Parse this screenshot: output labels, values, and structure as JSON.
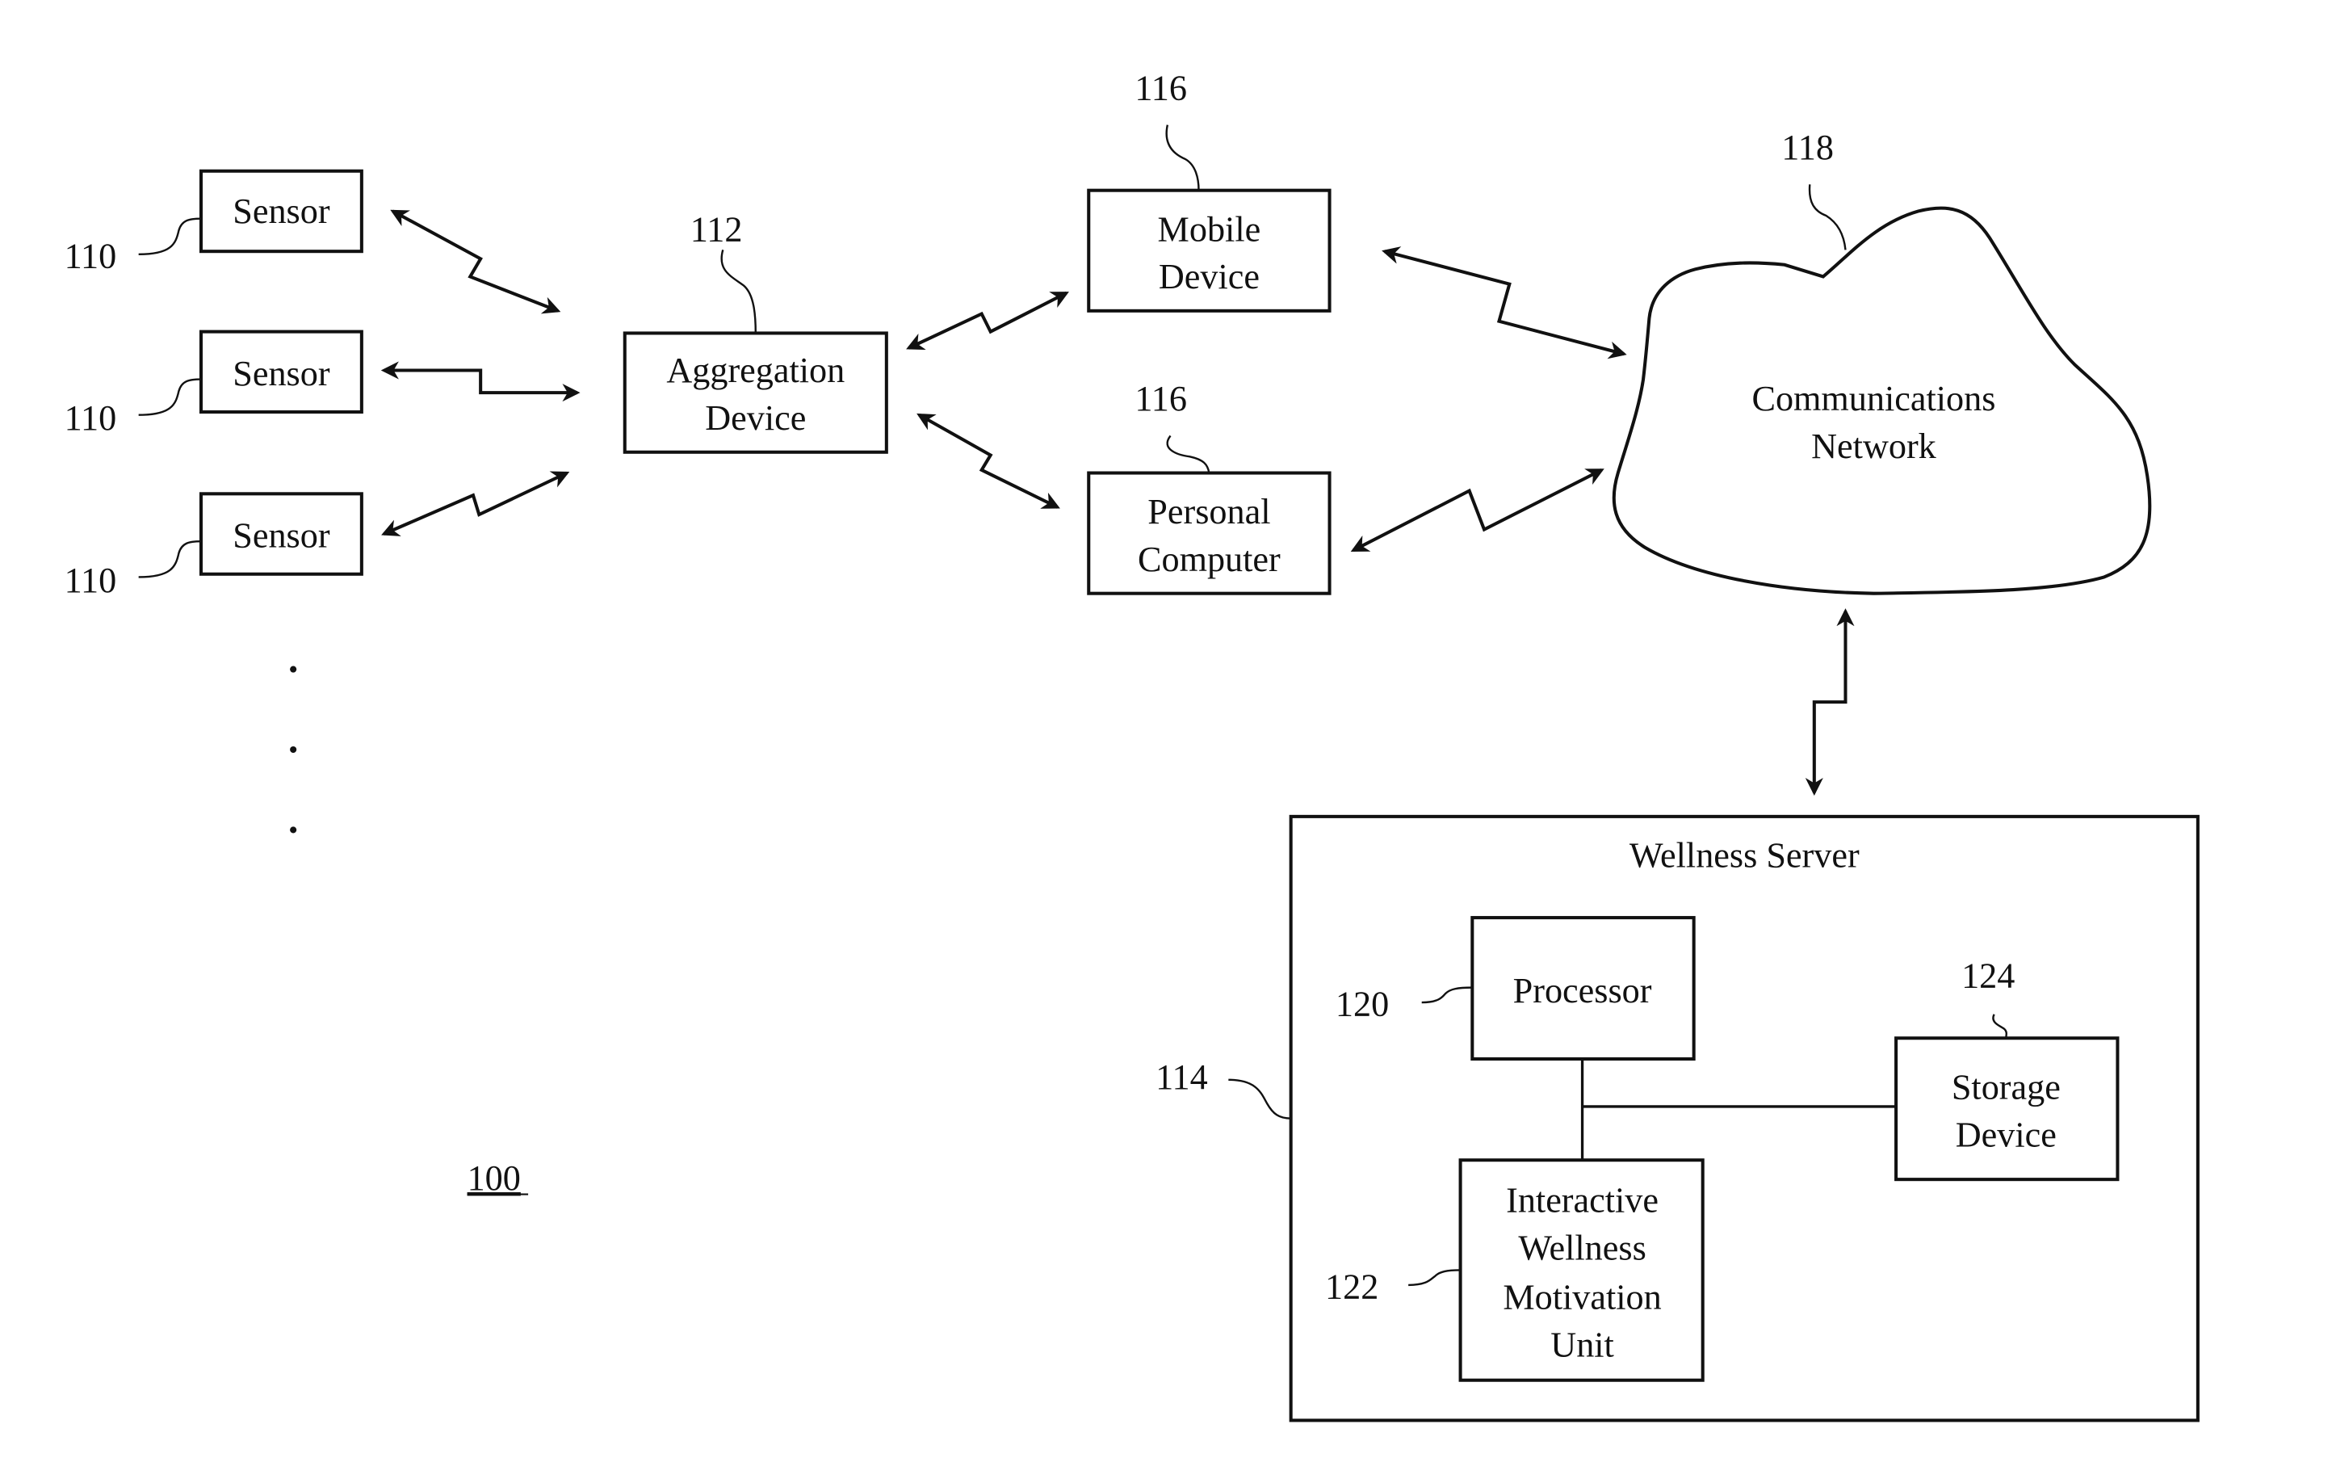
{
  "figure_label": "100",
  "sensors": [
    {
      "label": "Sensor",
      "ref": "110"
    },
    {
      "label": "Sensor",
      "ref": "110"
    },
    {
      "label": "Sensor",
      "ref": "110"
    }
  ],
  "aggregation_device": {
    "line1": "Aggregation",
    "line2": "Device",
    "ref": "112"
  },
  "mobile_device": {
    "line1": "Mobile",
    "line2": "Device",
    "ref": "116"
  },
  "personal_computer": {
    "line1": "Personal",
    "line2": "Computer",
    "ref": "116"
  },
  "communications_network": {
    "line1": "Communications",
    "line2": "Network",
    "ref": "118"
  },
  "wellness_server": {
    "title": "Wellness Server",
    "ref": "114",
    "processor": {
      "label": "Processor",
      "ref": "120"
    },
    "motivation_unit": {
      "line1": "Interactive",
      "line2": "Wellness",
      "line3": "Motivation",
      "line4": "Unit",
      "ref": "122"
    },
    "storage_device": {
      "line1": "Storage",
      "line2": "Device",
      "ref": "124"
    }
  },
  "ellipsis": "more sensors (vertical dots)"
}
